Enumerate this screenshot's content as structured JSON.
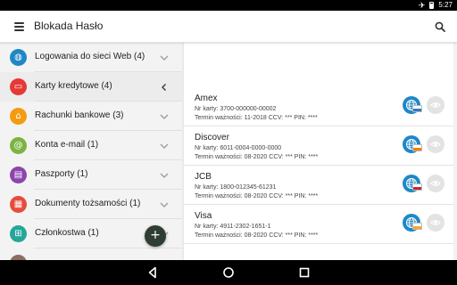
{
  "status": {
    "time": "5:27",
    "airplane_glyph": "✈"
  },
  "appbar": {
    "title": "Blokada Hasło"
  },
  "categories": [
    {
      "label": "Logowania do sieci Web (4)",
      "icon": "globe-icon",
      "color": "#1e88c7",
      "glyph": "◍",
      "expanded": false
    },
    {
      "label": "Karty kredytowe (4)",
      "icon": "credit-card-icon",
      "color": "#e53935",
      "glyph": "▭",
      "expanded": true
    },
    {
      "label": "Rachunki bankowe (3)",
      "icon": "bank-icon",
      "color": "#f39c12",
      "glyph": "⌂",
      "expanded": false
    },
    {
      "label": "Konta e-mail (1)",
      "icon": "at-icon",
      "color": "#7cb342",
      "glyph": "@",
      "expanded": false
    },
    {
      "label": "Paszporty (1)",
      "icon": "passport-icon",
      "color": "#8e44ad",
      "glyph": "▤",
      "expanded": false
    },
    {
      "label": "Dokumenty tożsamości (1)",
      "icon": "id-card-icon",
      "color": "#e74c3c",
      "glyph": "▦",
      "expanded": false
    },
    {
      "label": "Członkostwa (1)",
      "icon": "cart-icon",
      "color": "#26a69a",
      "glyph": "⊞",
      "expanded": false
    },
    {
      "label": "",
      "icon": "partial-item-icon",
      "color": "#8d6e63",
      "glyph": "",
      "expanded": false
    }
  ],
  "fab": {
    "label": "+"
  },
  "cards": [
    {
      "name": "Amex",
      "number_line": "Nr karty: 3700-000000-00002",
      "details_line": "Termin ważności: 11-2018 CCV: *** PIN: ****",
      "badge_color": "#2e7bc4"
    },
    {
      "name": "Discover",
      "number_line": "Nr karty: 6011-0004-0000-0000",
      "details_line": "Termin ważności: 08-2020 CCV: *** PIN: ****",
      "badge_color": "#f57c00"
    },
    {
      "name": "JCB",
      "number_line": "Nr karty: 1800-012345-61231",
      "details_line": "Termin ważności: 08-2020 CCV: *** PIN: ****",
      "badge_color": "#c62828"
    },
    {
      "name": "Visa",
      "number_line": "Nr karty: 4911-2302-1651-1",
      "details_line": "Termin ważności: 08-2020 CCV: *** PIN: ****",
      "badge_color": "#f9a825"
    }
  ],
  "colors": {
    "accent": "#1e88c7",
    "fab": "#2f3d33"
  }
}
